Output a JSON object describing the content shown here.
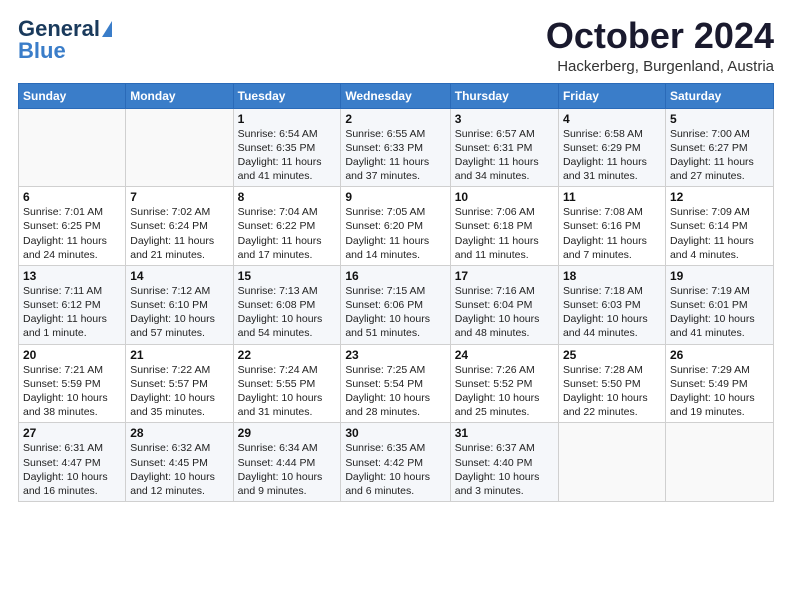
{
  "logo": {
    "general": "General",
    "blue": "Blue",
    "arrow": "▶"
  },
  "header": {
    "month": "October 2024",
    "location": "Hackerberg, Burgenland, Austria"
  },
  "weekdays": [
    "Sunday",
    "Monday",
    "Tuesday",
    "Wednesday",
    "Thursday",
    "Friday",
    "Saturday"
  ],
  "weeks": [
    [
      {
        "day": "",
        "sunrise": "",
        "sunset": "",
        "daylight": ""
      },
      {
        "day": "",
        "sunrise": "",
        "sunset": "",
        "daylight": ""
      },
      {
        "day": "1",
        "sunrise": "Sunrise: 6:54 AM",
        "sunset": "Sunset: 6:35 PM",
        "daylight": "Daylight: 11 hours and 41 minutes."
      },
      {
        "day": "2",
        "sunrise": "Sunrise: 6:55 AM",
        "sunset": "Sunset: 6:33 PM",
        "daylight": "Daylight: 11 hours and 37 minutes."
      },
      {
        "day": "3",
        "sunrise": "Sunrise: 6:57 AM",
        "sunset": "Sunset: 6:31 PM",
        "daylight": "Daylight: 11 hours and 34 minutes."
      },
      {
        "day": "4",
        "sunrise": "Sunrise: 6:58 AM",
        "sunset": "Sunset: 6:29 PM",
        "daylight": "Daylight: 11 hours and 31 minutes."
      },
      {
        "day": "5",
        "sunrise": "Sunrise: 7:00 AM",
        "sunset": "Sunset: 6:27 PM",
        "daylight": "Daylight: 11 hours and 27 minutes."
      }
    ],
    [
      {
        "day": "6",
        "sunrise": "Sunrise: 7:01 AM",
        "sunset": "Sunset: 6:25 PM",
        "daylight": "Daylight: 11 hours and 24 minutes."
      },
      {
        "day": "7",
        "sunrise": "Sunrise: 7:02 AM",
        "sunset": "Sunset: 6:24 PM",
        "daylight": "Daylight: 11 hours and 21 minutes."
      },
      {
        "day": "8",
        "sunrise": "Sunrise: 7:04 AM",
        "sunset": "Sunset: 6:22 PM",
        "daylight": "Daylight: 11 hours and 17 minutes."
      },
      {
        "day": "9",
        "sunrise": "Sunrise: 7:05 AM",
        "sunset": "Sunset: 6:20 PM",
        "daylight": "Daylight: 11 hours and 14 minutes."
      },
      {
        "day": "10",
        "sunrise": "Sunrise: 7:06 AM",
        "sunset": "Sunset: 6:18 PM",
        "daylight": "Daylight: 11 hours and 11 minutes."
      },
      {
        "day": "11",
        "sunrise": "Sunrise: 7:08 AM",
        "sunset": "Sunset: 6:16 PM",
        "daylight": "Daylight: 11 hours and 7 minutes."
      },
      {
        "day": "12",
        "sunrise": "Sunrise: 7:09 AM",
        "sunset": "Sunset: 6:14 PM",
        "daylight": "Daylight: 11 hours and 4 minutes."
      }
    ],
    [
      {
        "day": "13",
        "sunrise": "Sunrise: 7:11 AM",
        "sunset": "Sunset: 6:12 PM",
        "daylight": "Daylight: 11 hours and 1 minute."
      },
      {
        "day": "14",
        "sunrise": "Sunrise: 7:12 AM",
        "sunset": "Sunset: 6:10 PM",
        "daylight": "Daylight: 10 hours and 57 minutes."
      },
      {
        "day": "15",
        "sunrise": "Sunrise: 7:13 AM",
        "sunset": "Sunset: 6:08 PM",
        "daylight": "Daylight: 10 hours and 54 minutes."
      },
      {
        "day": "16",
        "sunrise": "Sunrise: 7:15 AM",
        "sunset": "Sunset: 6:06 PM",
        "daylight": "Daylight: 10 hours and 51 minutes."
      },
      {
        "day": "17",
        "sunrise": "Sunrise: 7:16 AM",
        "sunset": "Sunset: 6:04 PM",
        "daylight": "Daylight: 10 hours and 48 minutes."
      },
      {
        "day": "18",
        "sunrise": "Sunrise: 7:18 AM",
        "sunset": "Sunset: 6:03 PM",
        "daylight": "Daylight: 10 hours and 44 minutes."
      },
      {
        "day": "19",
        "sunrise": "Sunrise: 7:19 AM",
        "sunset": "Sunset: 6:01 PM",
        "daylight": "Daylight: 10 hours and 41 minutes."
      }
    ],
    [
      {
        "day": "20",
        "sunrise": "Sunrise: 7:21 AM",
        "sunset": "Sunset: 5:59 PM",
        "daylight": "Daylight: 10 hours and 38 minutes."
      },
      {
        "day": "21",
        "sunrise": "Sunrise: 7:22 AM",
        "sunset": "Sunset: 5:57 PM",
        "daylight": "Daylight: 10 hours and 35 minutes."
      },
      {
        "day": "22",
        "sunrise": "Sunrise: 7:24 AM",
        "sunset": "Sunset: 5:55 PM",
        "daylight": "Daylight: 10 hours and 31 minutes."
      },
      {
        "day": "23",
        "sunrise": "Sunrise: 7:25 AM",
        "sunset": "Sunset: 5:54 PM",
        "daylight": "Daylight: 10 hours and 28 minutes."
      },
      {
        "day": "24",
        "sunrise": "Sunrise: 7:26 AM",
        "sunset": "Sunset: 5:52 PM",
        "daylight": "Daylight: 10 hours and 25 minutes."
      },
      {
        "day": "25",
        "sunrise": "Sunrise: 7:28 AM",
        "sunset": "Sunset: 5:50 PM",
        "daylight": "Daylight: 10 hours and 22 minutes."
      },
      {
        "day": "26",
        "sunrise": "Sunrise: 7:29 AM",
        "sunset": "Sunset: 5:49 PM",
        "daylight": "Daylight: 10 hours and 19 minutes."
      }
    ],
    [
      {
        "day": "27",
        "sunrise": "Sunrise: 6:31 AM",
        "sunset": "Sunset: 4:47 PM",
        "daylight": "Daylight: 10 hours and 16 minutes."
      },
      {
        "day": "28",
        "sunrise": "Sunrise: 6:32 AM",
        "sunset": "Sunset: 4:45 PM",
        "daylight": "Daylight: 10 hours and 12 minutes."
      },
      {
        "day": "29",
        "sunrise": "Sunrise: 6:34 AM",
        "sunset": "Sunset: 4:44 PM",
        "daylight": "Daylight: 10 hours and 9 minutes."
      },
      {
        "day": "30",
        "sunrise": "Sunrise: 6:35 AM",
        "sunset": "Sunset: 4:42 PM",
        "daylight": "Daylight: 10 hours and 6 minutes."
      },
      {
        "day": "31",
        "sunrise": "Sunrise: 6:37 AM",
        "sunset": "Sunset: 4:40 PM",
        "daylight": "Daylight: 10 hours and 3 minutes."
      },
      {
        "day": "",
        "sunrise": "",
        "sunset": "",
        "daylight": ""
      },
      {
        "day": "",
        "sunrise": "",
        "sunset": "",
        "daylight": ""
      }
    ]
  ]
}
